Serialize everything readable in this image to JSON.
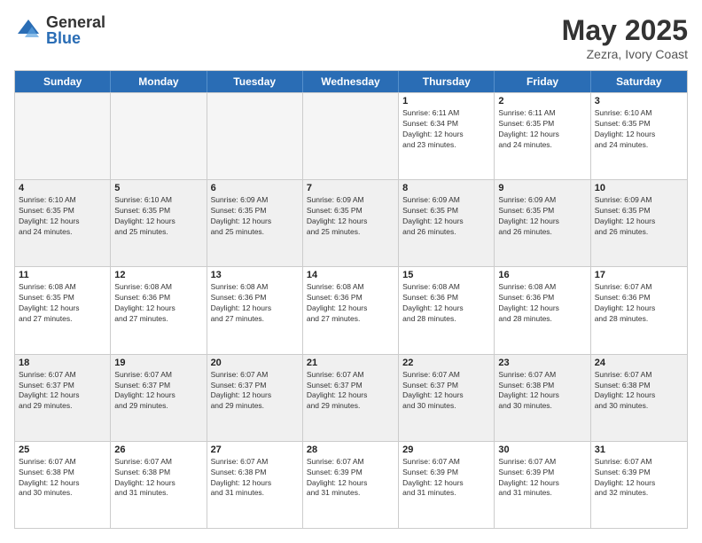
{
  "header": {
    "logo_general": "General",
    "logo_blue": "Blue",
    "month_title": "May 2025",
    "location": "Zezra, Ivory Coast"
  },
  "days_of_week": [
    "Sunday",
    "Monday",
    "Tuesday",
    "Wednesday",
    "Thursday",
    "Friday",
    "Saturday"
  ],
  "weeks": [
    [
      {
        "day": "",
        "info": "",
        "empty": true
      },
      {
        "day": "",
        "info": "",
        "empty": true
      },
      {
        "day": "",
        "info": "",
        "empty": true
      },
      {
        "day": "",
        "info": "",
        "empty": true
      },
      {
        "day": "1",
        "info": "Sunrise: 6:11 AM\nSunset: 6:34 PM\nDaylight: 12 hours\nand 23 minutes."
      },
      {
        "day": "2",
        "info": "Sunrise: 6:11 AM\nSunset: 6:35 PM\nDaylight: 12 hours\nand 24 minutes."
      },
      {
        "day": "3",
        "info": "Sunrise: 6:10 AM\nSunset: 6:35 PM\nDaylight: 12 hours\nand 24 minutes."
      }
    ],
    [
      {
        "day": "4",
        "info": "Sunrise: 6:10 AM\nSunset: 6:35 PM\nDaylight: 12 hours\nand 24 minutes."
      },
      {
        "day": "5",
        "info": "Sunrise: 6:10 AM\nSunset: 6:35 PM\nDaylight: 12 hours\nand 25 minutes."
      },
      {
        "day": "6",
        "info": "Sunrise: 6:09 AM\nSunset: 6:35 PM\nDaylight: 12 hours\nand 25 minutes."
      },
      {
        "day": "7",
        "info": "Sunrise: 6:09 AM\nSunset: 6:35 PM\nDaylight: 12 hours\nand 25 minutes."
      },
      {
        "day": "8",
        "info": "Sunrise: 6:09 AM\nSunset: 6:35 PM\nDaylight: 12 hours\nand 26 minutes."
      },
      {
        "day": "9",
        "info": "Sunrise: 6:09 AM\nSunset: 6:35 PM\nDaylight: 12 hours\nand 26 minutes."
      },
      {
        "day": "10",
        "info": "Sunrise: 6:09 AM\nSunset: 6:35 PM\nDaylight: 12 hours\nand 26 minutes."
      }
    ],
    [
      {
        "day": "11",
        "info": "Sunrise: 6:08 AM\nSunset: 6:35 PM\nDaylight: 12 hours\nand 27 minutes."
      },
      {
        "day": "12",
        "info": "Sunrise: 6:08 AM\nSunset: 6:36 PM\nDaylight: 12 hours\nand 27 minutes."
      },
      {
        "day": "13",
        "info": "Sunrise: 6:08 AM\nSunset: 6:36 PM\nDaylight: 12 hours\nand 27 minutes."
      },
      {
        "day": "14",
        "info": "Sunrise: 6:08 AM\nSunset: 6:36 PM\nDaylight: 12 hours\nand 27 minutes."
      },
      {
        "day": "15",
        "info": "Sunrise: 6:08 AM\nSunset: 6:36 PM\nDaylight: 12 hours\nand 28 minutes."
      },
      {
        "day": "16",
        "info": "Sunrise: 6:08 AM\nSunset: 6:36 PM\nDaylight: 12 hours\nand 28 minutes."
      },
      {
        "day": "17",
        "info": "Sunrise: 6:07 AM\nSunset: 6:36 PM\nDaylight: 12 hours\nand 28 minutes."
      }
    ],
    [
      {
        "day": "18",
        "info": "Sunrise: 6:07 AM\nSunset: 6:37 PM\nDaylight: 12 hours\nand 29 minutes."
      },
      {
        "day": "19",
        "info": "Sunrise: 6:07 AM\nSunset: 6:37 PM\nDaylight: 12 hours\nand 29 minutes."
      },
      {
        "day": "20",
        "info": "Sunrise: 6:07 AM\nSunset: 6:37 PM\nDaylight: 12 hours\nand 29 minutes."
      },
      {
        "day": "21",
        "info": "Sunrise: 6:07 AM\nSunset: 6:37 PM\nDaylight: 12 hours\nand 29 minutes."
      },
      {
        "day": "22",
        "info": "Sunrise: 6:07 AM\nSunset: 6:37 PM\nDaylight: 12 hours\nand 30 minutes."
      },
      {
        "day": "23",
        "info": "Sunrise: 6:07 AM\nSunset: 6:38 PM\nDaylight: 12 hours\nand 30 minutes."
      },
      {
        "day": "24",
        "info": "Sunrise: 6:07 AM\nSunset: 6:38 PM\nDaylight: 12 hours\nand 30 minutes."
      }
    ],
    [
      {
        "day": "25",
        "info": "Sunrise: 6:07 AM\nSunset: 6:38 PM\nDaylight: 12 hours\nand 30 minutes."
      },
      {
        "day": "26",
        "info": "Sunrise: 6:07 AM\nSunset: 6:38 PM\nDaylight: 12 hours\nand 31 minutes."
      },
      {
        "day": "27",
        "info": "Sunrise: 6:07 AM\nSunset: 6:38 PM\nDaylight: 12 hours\nand 31 minutes."
      },
      {
        "day": "28",
        "info": "Sunrise: 6:07 AM\nSunset: 6:39 PM\nDaylight: 12 hours\nand 31 minutes."
      },
      {
        "day": "29",
        "info": "Sunrise: 6:07 AM\nSunset: 6:39 PM\nDaylight: 12 hours\nand 31 minutes."
      },
      {
        "day": "30",
        "info": "Sunrise: 6:07 AM\nSunset: 6:39 PM\nDaylight: 12 hours\nand 31 minutes."
      },
      {
        "day": "31",
        "info": "Sunrise: 6:07 AM\nSunset: 6:39 PM\nDaylight: 12 hours\nand 32 minutes."
      }
    ]
  ]
}
